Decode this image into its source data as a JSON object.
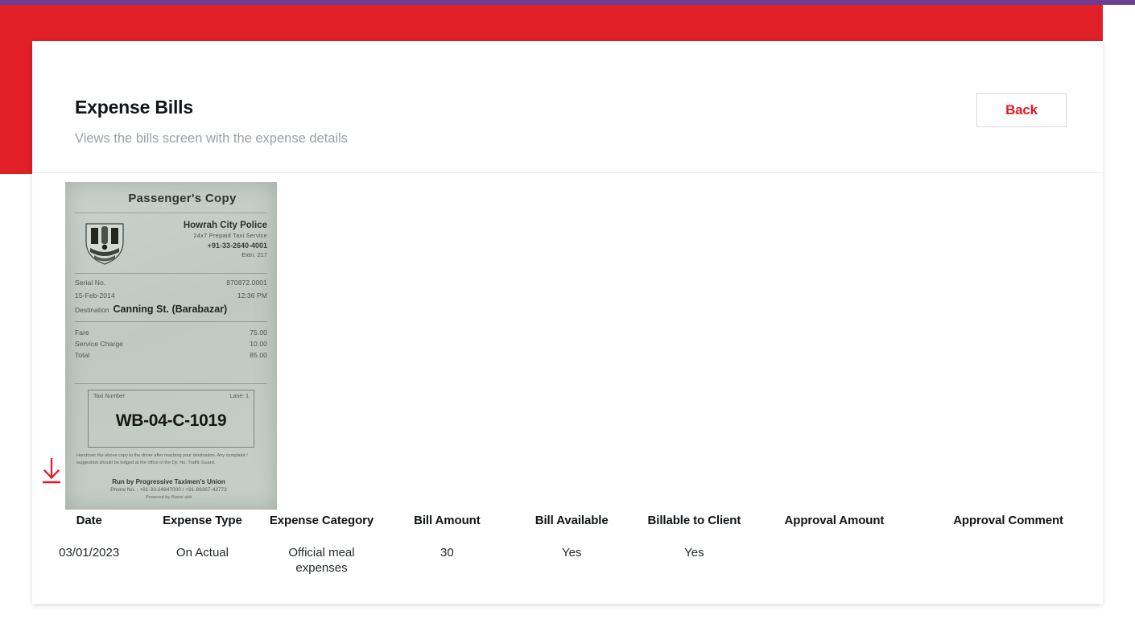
{
  "theme": {
    "brand_red": "#e01f26",
    "accent_purple": "#6c3d91",
    "link_red": "#e8161f",
    "text_dark": "#111418",
    "text_muted": "#9aa0a6"
  },
  "header": {
    "title": "Expense Bills",
    "subtitle": "Views the bills screen with the expense details",
    "back_label": "Back"
  },
  "bill": {
    "download_icon": "download-icon",
    "receipt": {
      "title": "Passenger's Copy",
      "emblem": "police-crest-emblem",
      "org_name": "Howrah City Police",
      "org_service": "24x7 Prepaid Taxi Service",
      "org_phone": "+91-33-2640-4001",
      "org_extn": "Extn. 217",
      "serial_label": "Serial No.",
      "serial_value": "870872.0001",
      "date_value": "15-Feb-2014",
      "time_value": "12:36 PM",
      "destination_label": "Destination",
      "destination_value": "Canning St. (Barabazar)",
      "fare_label": "Fare",
      "fare_value": "75.00",
      "service_label": "Service Charge",
      "service_value": "10.00",
      "total_label": "Total",
      "total_value": "85.00",
      "taxi_number_label": "Taxi Number",
      "lane_label": "Lane: 1",
      "taxi_number": "WB-04-C-1019",
      "note": "Handover the above copy to the driver after reaching your destination. Any complaint / suggestion should be lodged at the office of the Dy. No. Traffic Guard.",
      "footer_run_by": "Run by Progressive Taximen's Union",
      "footer_phone": "Phone No. : +91-33-24947000 / +91-89367-43773",
      "footer_powered": "Powered by Bansi akti"
    }
  },
  "table": {
    "columns": [
      "Date",
      "Expense Type",
      "Expense Category",
      "Bill Amount",
      "Bill Available",
      "Billable to Client",
      "Approval Amount",
      "Approval Comment"
    ],
    "rows": [
      {
        "date": "03/01/2023",
        "expense_type": "On Actual",
        "expense_category": "Official meal expenses",
        "bill_amount": "30",
        "bill_available": "Yes",
        "billable_to_client": "Yes",
        "approval_amount": "",
        "approval_comment": ""
      }
    ]
  }
}
